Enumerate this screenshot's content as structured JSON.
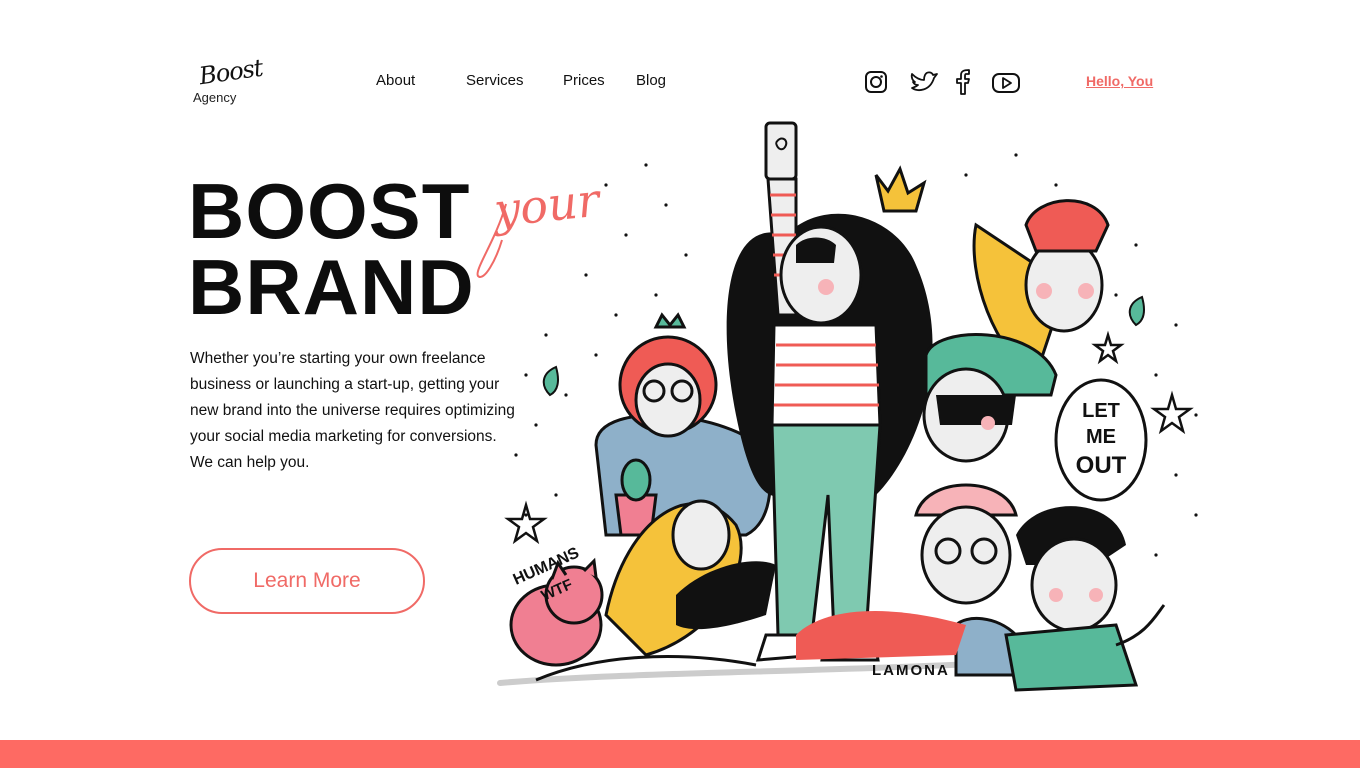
{
  "brand": {
    "logo_script": "Boost",
    "logo_sub": "Agency"
  },
  "nav": {
    "about": "About",
    "services": "Services",
    "prices": "Prices",
    "blog": "Blog"
  },
  "social": [
    "instagram-icon",
    "twitter-icon",
    "facebook-icon",
    "youtube-icon"
  ],
  "greeting": "Hello, You",
  "hero": {
    "line1": "BOOST",
    "accent": "your",
    "line2": "BRAND",
    "paragraph": "Whether you’re starting your own freelance business or launching a start-up, getting your new brand into the universe requires optimizing your social media marketing for conversions. We can help you.",
    "cta": "Learn More"
  },
  "illustration": {
    "texts": {
      "humans": "HUMANS",
      "wtf": "WTF",
      "speech_l1": "LET",
      "speech_l2": "ME",
      "speech_l3": "OUT",
      "signature": "LAMONA"
    }
  },
  "colors": {
    "accent": "#f06a66",
    "footer": "#fe6a63",
    "text": "#111111"
  }
}
